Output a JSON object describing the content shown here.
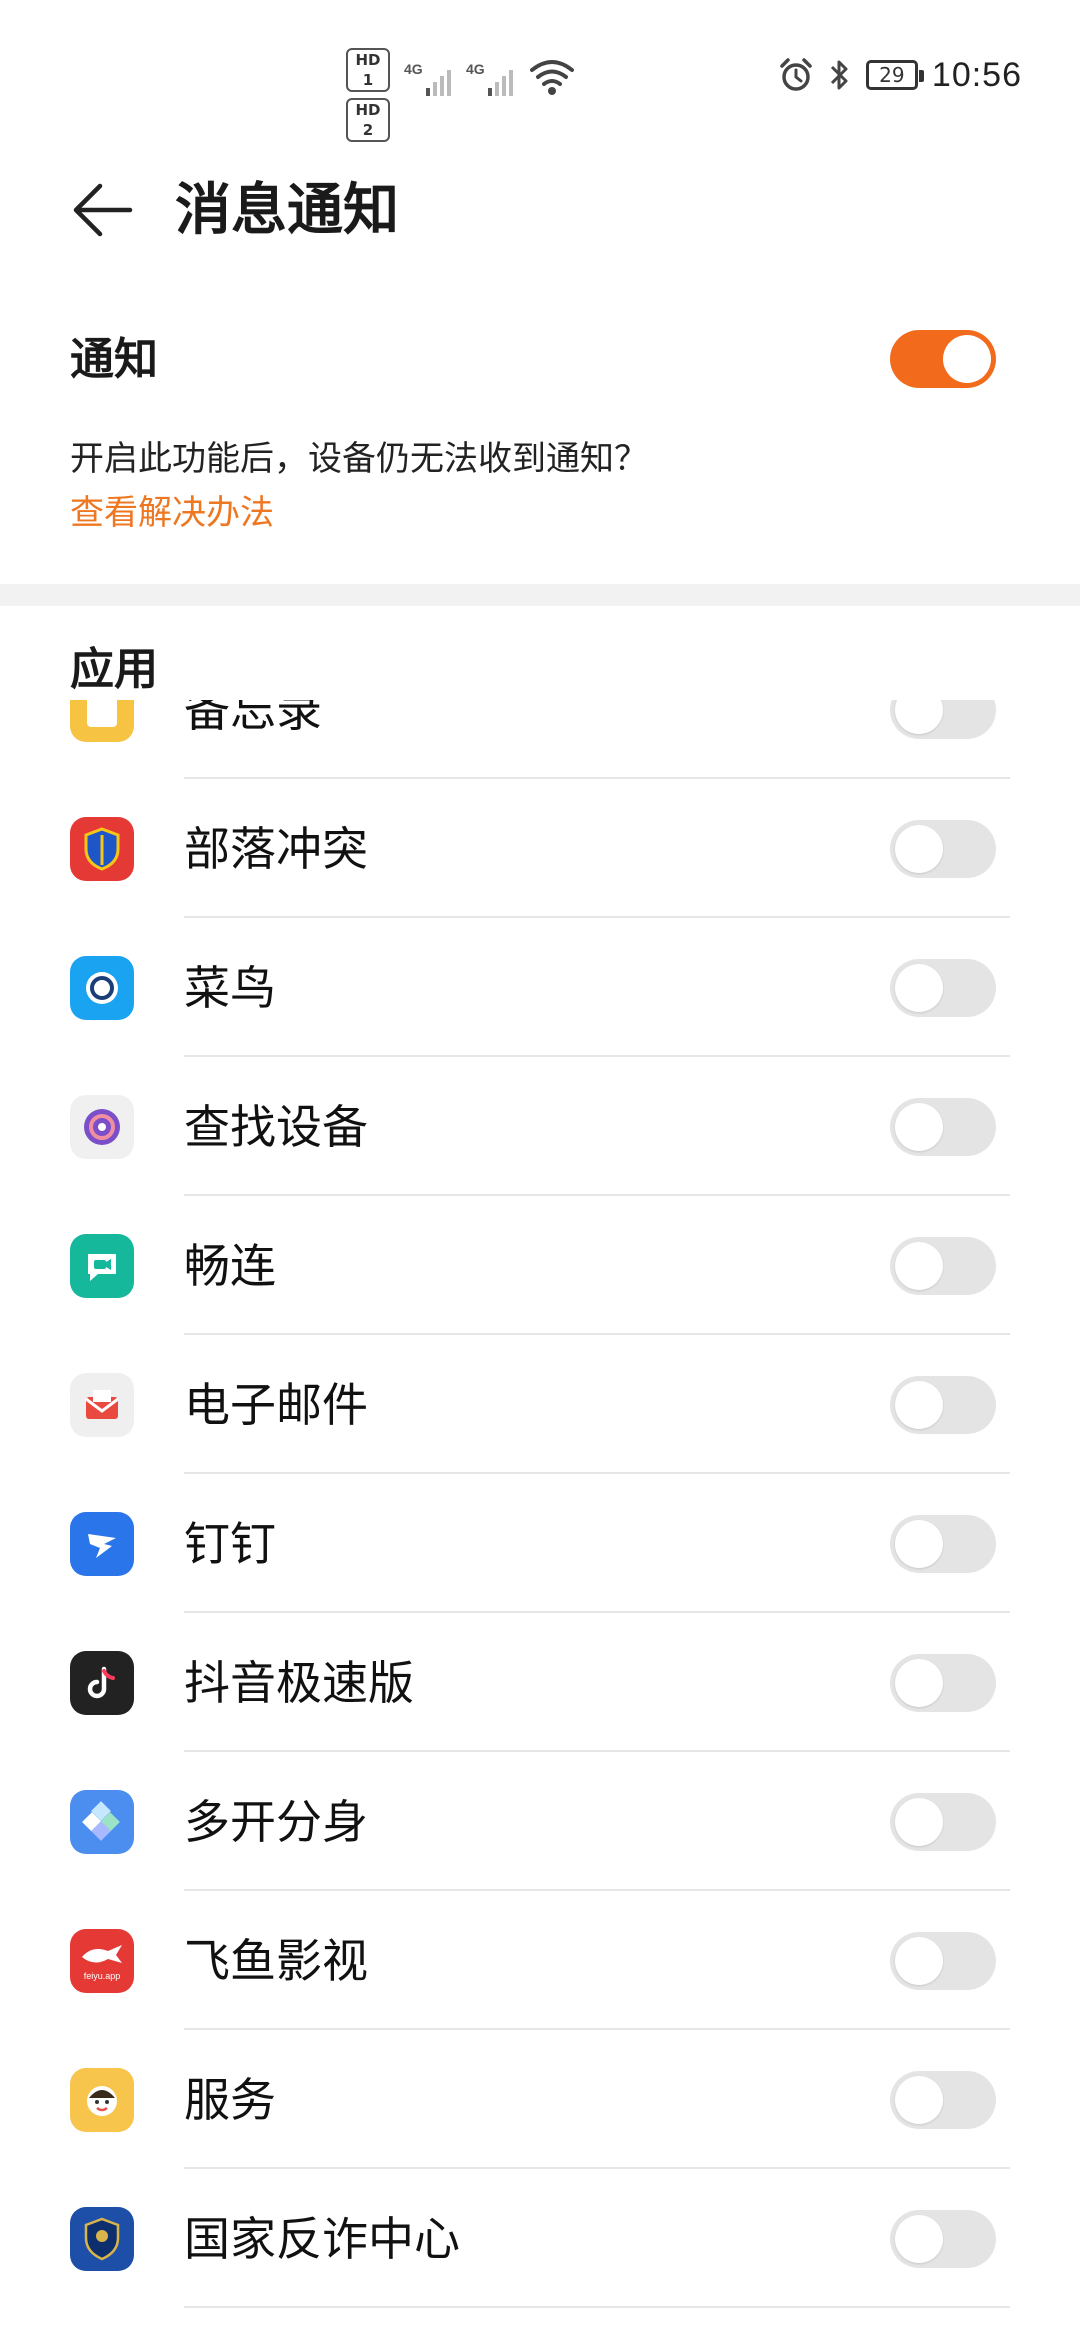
{
  "status_bar": {
    "sim1": "HD 1",
    "sim2": "HD 2",
    "net1": "4G",
    "net2": "4G",
    "battery": "29",
    "time": "10:56",
    "icons": [
      "alarm-icon",
      "bluetooth-icon",
      "wifi-icon",
      "signal-icon"
    ]
  },
  "header": {
    "title": "消息通知",
    "back_icon": "back-arrow-icon"
  },
  "notification": {
    "label": "通知",
    "enabled": true,
    "help_text": "开启此功能后，设备仍无法收到通知？",
    "help_link": "查看解决办法"
  },
  "apps_section": {
    "title": "应用",
    "items": [
      {
        "name": "备忘录",
        "enabled": false,
        "icon": "memo-icon",
        "icon_color": "#f6c343"
      },
      {
        "name": "部落冲突",
        "enabled": false,
        "icon": "clash-of-clans-icon",
        "icon_color": "#e53935"
      },
      {
        "name": "菜鸟",
        "enabled": false,
        "icon": "cainiao-icon",
        "icon_color": "#1aa3f0"
      },
      {
        "name": "查找设备",
        "enabled": false,
        "icon": "find-device-icon",
        "icon_color": "#f0f0f0"
      },
      {
        "name": "畅连",
        "enabled": false,
        "icon": "meetime-icon",
        "icon_color": "#15b89a"
      },
      {
        "name": "电子邮件",
        "enabled": false,
        "icon": "email-icon",
        "icon_color": "#efefef"
      },
      {
        "name": "钉钉",
        "enabled": false,
        "icon": "dingtalk-icon",
        "icon_color": "#2a75ea"
      },
      {
        "name": "抖音极速版",
        "enabled": false,
        "icon": "douyin-lite-icon",
        "icon_color": "#222222"
      },
      {
        "name": "多开分身",
        "enabled": false,
        "icon": "multi-space-icon",
        "icon_color": "#4b8ef0"
      },
      {
        "name": "飞鱼影视",
        "enabled": false,
        "icon": "feiyu-video-icon",
        "icon_color": "#e53935",
        "icon_text": "feiyu.app"
      },
      {
        "name": "服务",
        "enabled": false,
        "icon": "service-icon",
        "icon_color": "#f7c44c"
      },
      {
        "name": "国家反诈中心",
        "enabled": false,
        "icon": "anti-fraud-icon",
        "icon_color": "#1d4fa8"
      }
    ]
  },
  "colors": {
    "accent": "#f26b1d",
    "link": "#ee7722",
    "toggle_off": "#e4e4e4"
  }
}
